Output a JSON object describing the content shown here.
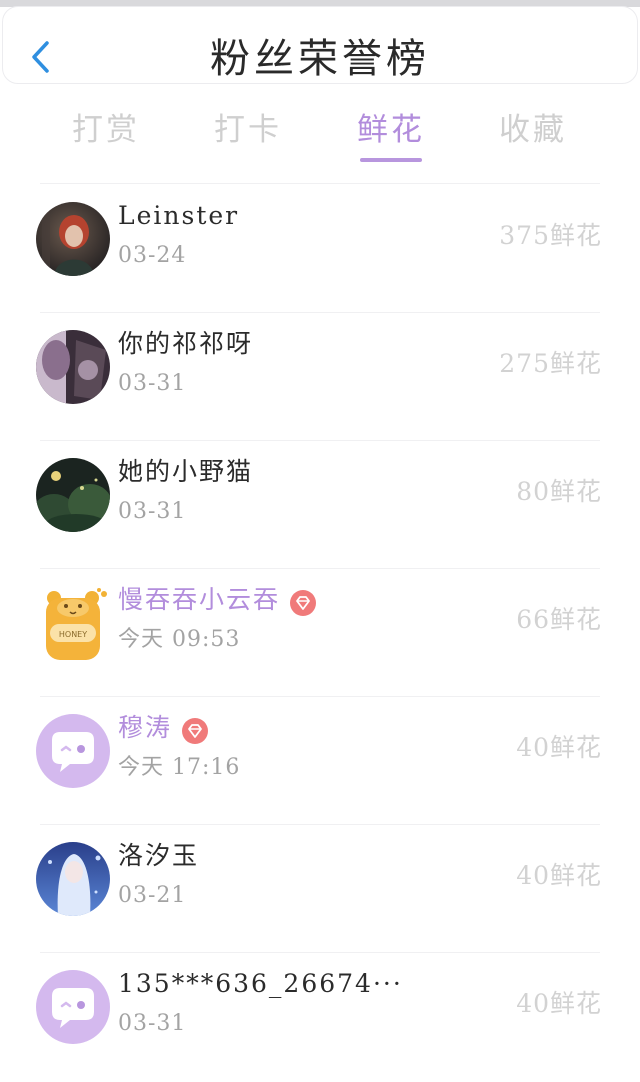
{
  "header": {
    "title": "粉丝荣誉榜",
    "back_icon": "chevron-left-icon",
    "accent": "#2f8fe0"
  },
  "tabs": [
    {
      "label": "打赏",
      "active": false
    },
    {
      "label": "打卡",
      "active": false
    },
    {
      "label": "鲜花",
      "active": true
    },
    {
      "label": "收藏",
      "active": false
    }
  ],
  "colors": {
    "accent_purple": "#b28ddc",
    "muted_text": "#a3a3a3",
    "amount_text": "#d2d2d2",
    "vip_badge": "#f07a7a"
  },
  "fans": [
    {
      "name": "Leinster",
      "date": "03-24",
      "amount": "375鲜花",
      "vip": false,
      "avatar": "photo-redhair"
    },
    {
      "name": "你的祁祁呀",
      "date": "03-31",
      "amount": "275鲜花",
      "vip": false,
      "avatar": "photo-dark-purple"
    },
    {
      "name": "她的小野猫",
      "date": "03-31",
      "amount": "80鲜花",
      "vip": false,
      "avatar": "photo-forest-night"
    },
    {
      "name": "慢吞吞小云吞",
      "date": "今天 09:53",
      "amount": "66鲜花",
      "vip": true,
      "avatar": "honey-jar-bear",
      "avatar_text": "HONEY"
    },
    {
      "name": "穆涛",
      "date": "今天 17:16",
      "amount": "40鲜花",
      "vip": true,
      "avatar": "default-chat-bubble"
    },
    {
      "name": "洛汐玉",
      "date": "03-21",
      "amount": "40鲜花",
      "vip": false,
      "avatar": "photo-anime-blue"
    },
    {
      "name": "135***636_26674···",
      "date": "03-31",
      "amount": "40鲜花",
      "vip": false,
      "avatar": "default-chat-bubble"
    }
  ]
}
